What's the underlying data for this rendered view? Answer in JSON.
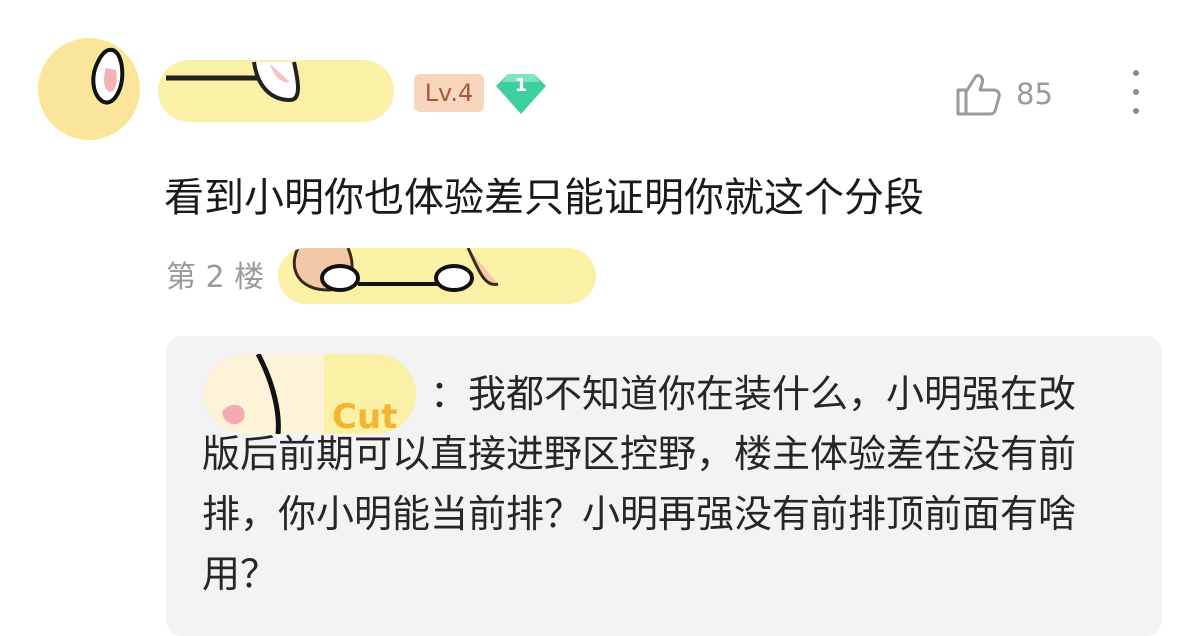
{
  "user": {
    "level_badge": "Lv.4",
    "gem_number": "1",
    "colors": {
      "level_bg": "#f8d5bd",
      "level_text": "#a65a3a",
      "gem": "#3ecfa0"
    }
  },
  "like": {
    "icon": "thumbs-up-icon",
    "count": "85"
  },
  "more": {
    "icon": "more-vertical-icon"
  },
  "comment": {
    "text": "看到小明你也体验差只能证明你就这个分段",
    "floor": "第 2 楼"
  },
  "reply": {
    "text": "：我都不知道你在装什么，小明强在改版后前期可以直接进野区控野，楼主体验差在没有前排，你小明能当前排？小明再强没有前排顶前面有啥用？"
  }
}
